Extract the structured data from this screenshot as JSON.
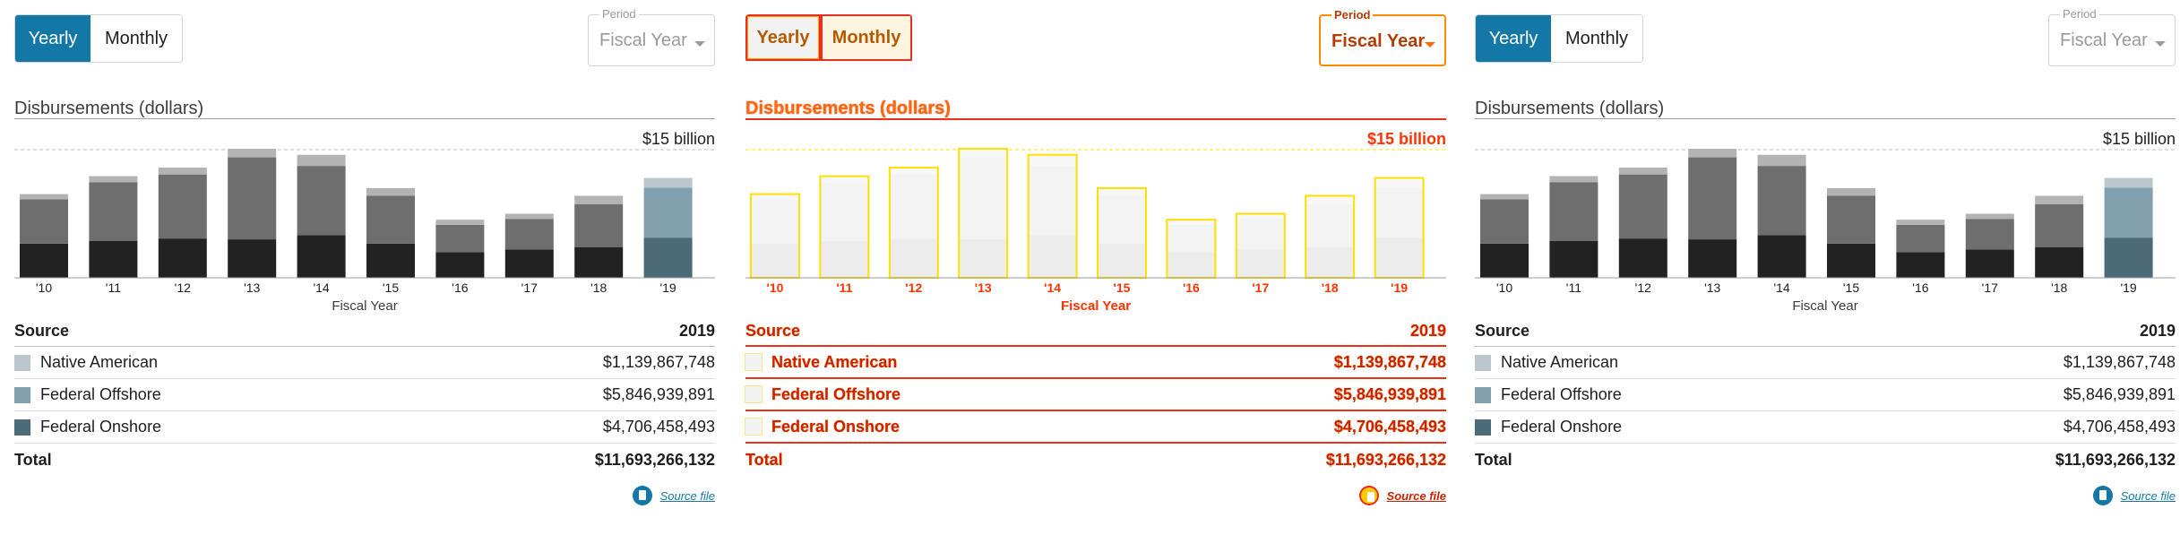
{
  "toggle": {
    "yearly_label": "Yearly",
    "monthly_label": "Monthly"
  },
  "period": {
    "label": "Period",
    "value": "Fiscal Year"
  },
  "chart_title": "Disbursements (dollars)",
  "colors": {
    "native_american": "#bcc7cd",
    "federal_offshore": "#82a0ad",
    "federal_onshore": "#4d6a79",
    "bar_dark": "#222222",
    "bar_mid": "#6e6e6e",
    "bar_light": "#b3b3b3",
    "accent": "#1478a7"
  },
  "chart_data": {
    "type": "bar",
    "stacked": true,
    "title": "Disbursements (dollars)",
    "xlabel": "Fiscal Year",
    "ylabel": "",
    "max_label": "$15 billion",
    "ylim": [
      0,
      15000000000
    ],
    "categories": [
      "'10",
      "'11",
      "'12",
      "'13",
      "'14",
      "'15",
      "'16",
      "'17",
      "'18",
      "'19"
    ],
    "highlight_index": 9,
    "series": [
      {
        "name": "Federal Onshore",
        "values": [
          4000000000.0,
          4300000000.0,
          4600000000.0,
          4500000000.0,
          5000000000.0,
          4000000000.0,
          3000000000.0,
          3300000000.0,
          3600000000.0,
          4706458493.0
        ]
      },
      {
        "name": "Federal Offshore",
        "values": [
          5200000000.0,
          6900000000.0,
          7500000000.0,
          9600000000.0,
          8100000000.0,
          5600000000.0,
          3200000000.0,
          3600000000.0,
          5000000000.0,
          5846939891.0
        ]
      },
      {
        "name": "Native American",
        "values": [
          600000000.0,
          700000000.0,
          800000000.0,
          1000000000.0,
          1300000000.0,
          900000000.0,
          600000000.0,
          600000000.0,
          1000000000.0,
          1139867748.0
        ]
      }
    ]
  },
  "table": {
    "header_source": "Source",
    "header_year": "2019",
    "rows": [
      {
        "name": "Native American",
        "value": "$1,139,867,748"
      },
      {
        "name": "Federal Offshore",
        "value": "$5,846,939,891"
      },
      {
        "name": "Federal Onshore",
        "value": "$4,706,458,493"
      }
    ],
    "total_label": "Total",
    "total_value": "$11,693,266,132"
  },
  "source_file_label": "Source file"
}
